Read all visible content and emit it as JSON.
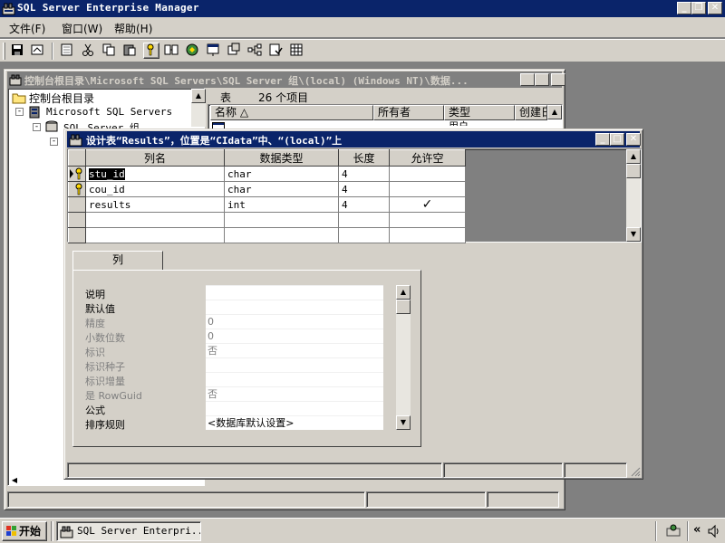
{
  "app": {
    "title": "SQL Server Enterprise Manager"
  },
  "menu": {
    "items": [
      "文件(F)",
      "窗口(W)",
      "帮助(H)"
    ]
  },
  "console": {
    "title": "控制台根目录\\Microsoft SQL Servers\\SQL Server 组\\(local) (Windows NT)\\数据...",
    "tree": {
      "root": "控制台根目录",
      "child": "Microsoft SQL Servers",
      "group": "SQL Server 组"
    },
    "list": {
      "summary_label": "表",
      "summary_count": "26 个项目",
      "columns": [
        "名称 △",
        "所有者",
        "类型",
        "创建日"
      ],
      "partial_row_type": "用户"
    }
  },
  "design": {
    "title": "设计表“Results”，位置是“CIdata”中、“(local)”上",
    "columns": [
      "列名",
      "数据类型",
      "长度",
      "允许空"
    ],
    "rows": [
      {
        "name": "stu_id",
        "type": "char",
        "length": "4",
        "nullable": ""
      },
      {
        "name": "cou_id",
        "type": "char",
        "length": "4",
        "nullable": ""
      },
      {
        "name": "results",
        "type": "int",
        "length": "4",
        "nullable": "✓"
      }
    ],
    "tab": "列",
    "properties": [
      {
        "label": "说明",
        "value": "",
        "enabled": true
      },
      {
        "label": "默认值",
        "value": "",
        "enabled": true
      },
      {
        "label": "精度",
        "value": "0",
        "enabled": false
      },
      {
        "label": "小数位数",
        "value": "0",
        "enabled": false
      },
      {
        "label": "标识",
        "value": "否",
        "enabled": false
      },
      {
        "label": "标识种子",
        "value": "",
        "enabled": false
      },
      {
        "label": "标识增量",
        "value": "",
        "enabled": false
      },
      {
        "label": "是 RowGuid",
        "value": "否",
        "enabled": false
      },
      {
        "label": "公式",
        "value": "",
        "enabled": true
      },
      {
        "label": "排序规则",
        "value": "<数据库默认设置>",
        "enabled": true
      }
    ]
  },
  "taskbar": {
    "start_label": "开始",
    "task_label": "SQL Server Enterpri...",
    "tray_arrows": "«"
  },
  "colors": {
    "active_title": "#0a246a",
    "inactive_title": "#808080",
    "face": "#d4d0c8",
    "desktop": "#808080"
  }
}
